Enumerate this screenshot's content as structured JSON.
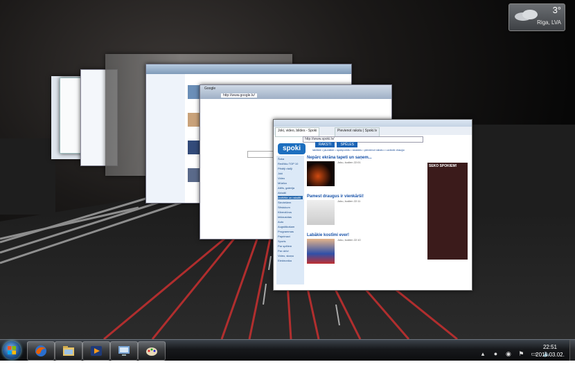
{
  "weather": {
    "temperature": "3°",
    "city": "Riga, LVA",
    "icon": "cloud-icon"
  },
  "windows": {
    "explorer": {
      "icon": "folder-window-icon"
    },
    "google": {
      "tab_label": "Google",
      "address": "http://www.google.lv/"
    },
    "spoki": {
      "tab_label": "Joki, video, bildes - Spoki",
      "tab2_label": "Pievienot rakstu | Spoki.lv",
      "address": "http://www.spoki.lv/",
      "logo": "spoki",
      "nav_tabs": [
        "RAKSTI",
        "SPĒLES"
      ],
      "categories": "labākie • jaunākie • spokpoints • skaides • pievienot rakstu • uzdroši drauģo",
      "sidebar": [
        "Šoka",
        "Redīššu TOP 10",
        "Pēdēji rādīji",
        "Joki",
        "Video",
        "Mūzika",
        "Atēls, galerija",
        "Aktuāli",
        "Izvēlētie un rakstīti",
        "Sieviešiem",
        "Sēstukum",
        "Kiberzlūrus",
        "Ieklausidas",
        "Auto",
        "Augstākošam",
        "Programmas",
        "Paprimavi",
        "Sports",
        "Par spēlem",
        "Par dzīvi",
        "Video, skaņu",
        "Elektronika"
      ],
      "articles": [
        {
          "title": "Nepārc ekrāna tapeti un saņem...",
          "meta": "Joku, šodien 22:01"
        },
        {
          "title": "Pamest draugus ir vienkārši!",
          "meta": "Joku, šodien 22:11"
        },
        {
          "title": "Labākie kostīmi ever!",
          "meta": "Joku, šodien 22:10"
        }
      ],
      "ad_text": "SEKO SPOKIEM!"
    }
  },
  "taskbar": {
    "start_icon": "windows-start-icon",
    "apps": [
      {
        "name": "firefox-icon"
      },
      {
        "name": "explorer-icon"
      },
      {
        "name": "media-player-icon"
      },
      {
        "name": "remote-desktop-icon"
      },
      {
        "name": "paint-icon"
      }
    ],
    "tray_icons": [
      "show-hidden-icon",
      "skype-icon",
      "network-icon",
      "flag-icon",
      "battery-icon",
      "volume-icon"
    ],
    "time": "22:51",
    "date": "2011.03.02."
  }
}
